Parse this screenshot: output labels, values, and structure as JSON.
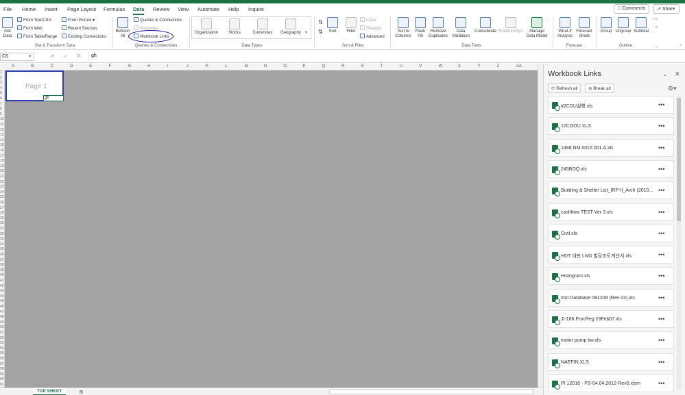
{
  "colors": {
    "accent": "#1e7145",
    "highlight_ring": "#1a1aa6",
    "sheet_bg": "#a3a3a3"
  },
  "menu": {
    "tabs": [
      "File",
      "Home",
      "Insert",
      "Page Layout",
      "Formulas",
      "Data",
      "Review",
      "View",
      "Automate",
      "Help",
      "Inquire"
    ],
    "active": "Data",
    "comments": "Comments",
    "share": "Share"
  },
  "ribbon": {
    "get_transform": {
      "get_data": "Get Data",
      "from_text_csv": "From Text/CSV",
      "from_web": "From Web",
      "from_table_range": "From Table/Range",
      "from_picture": "From Picture",
      "recent_sources": "Recent Sources",
      "existing_connections": "Existing Connections",
      "label": "Get & Transform Data"
    },
    "queries": {
      "refresh_all": "Refresh All",
      "queries_connections": "Queries & Connections",
      "properties": "Properties",
      "workbook_links": "Workbook Links",
      "label": "Queries & Connections"
    },
    "data_types": {
      "items": [
        "Organization",
        "Stocks",
        "Currencies",
        "Geography"
      ],
      "label": "Data Types"
    },
    "sort_filter": {
      "sort": "Sort",
      "filter": "Filter",
      "clear": "Clear",
      "reapply": "Reapply",
      "advanced": "Advanced",
      "label": "Sort & Filter"
    },
    "data_tools": {
      "text_to_columns": "Text to Columns",
      "flash_fill": "Flash Fill",
      "remove_duplicates": "Remove Duplicates",
      "data_validation": "Data Validation",
      "consolidate": "Consolidate",
      "relationships": "Relationships",
      "manage_data_model": "Manage Data Model",
      "label": "Data Tools"
    },
    "forecast": {
      "what_if": "What-If Analysis",
      "forecast_sheet": "Forecast Sheet",
      "label": "Forecast"
    },
    "outline": {
      "group": "Group",
      "ungroup": "Ungroup",
      "subtotal": "Subtotal",
      "label": "Outline"
    }
  },
  "formula_bar": {
    "name_box": "C6",
    "fx": "fx",
    "value": "gh"
  },
  "grid": {
    "columns": [
      "A",
      "B",
      "C",
      "D",
      "E",
      "F",
      "G",
      "H",
      "I",
      "J",
      "K",
      "L",
      "M",
      "N",
      "O",
      "P",
      "Q",
      "R",
      "S",
      "T",
      "U",
      "V",
      "W",
      "X",
      "Y",
      "Z",
      "AA"
    ],
    "rows": [
      "1",
      "2",
      "3",
      "4",
      "5",
      "6",
      "7",
      "8",
      "9",
      "10",
      "11",
      "12",
      "13",
      "14",
      "15",
      "16",
      "17",
      "18",
      "19",
      "20",
      "21",
      "22",
      "23",
      "24",
      "25",
      "26",
      "27",
      "28",
      "29",
      "30",
      "31",
      "32",
      "33",
      "34",
      "35",
      "36",
      "37",
      "38",
      "39",
      "40",
      "41",
      "42",
      "43",
      "44",
      "45",
      "46",
      "47",
      "48",
      "49",
      "50",
      "51",
      "52",
      "53",
      "54",
      "55",
      "56",
      "57",
      "58",
      "59",
      "60",
      "61"
    ],
    "page_label": "Page 1",
    "active_cell_text": "gh"
  },
  "sheet_tabs": {
    "active": "TOP SHEET"
  },
  "workbook_links_pane": {
    "title": "Workbook Links",
    "refresh_all": "Refresh all",
    "break_all": "Break all",
    "links": [
      "#2CDU실행.xls",
      "12CGOU.XLS",
      "1488.NM.0022.001.A.xls",
      "245BOQ.xls",
      "Building & Shelter List_IRP-II_Arch (2010...",
      "cashflow TEST Ver 3.xls",
      "Civil.xls",
      "HDT 대만 LNG 빌딩조도계산서.xls",
      "Histogram.xls",
      "Inst Database 081208 (Rev 03).xls",
      "JI-186 ProcReg 23Feb07.xls",
      "motor pump kw.xls",
      "NAEFIN.XLS",
      "PI 12016 - PS-04.04.2012-Rev0.xlsm"
    ]
  }
}
